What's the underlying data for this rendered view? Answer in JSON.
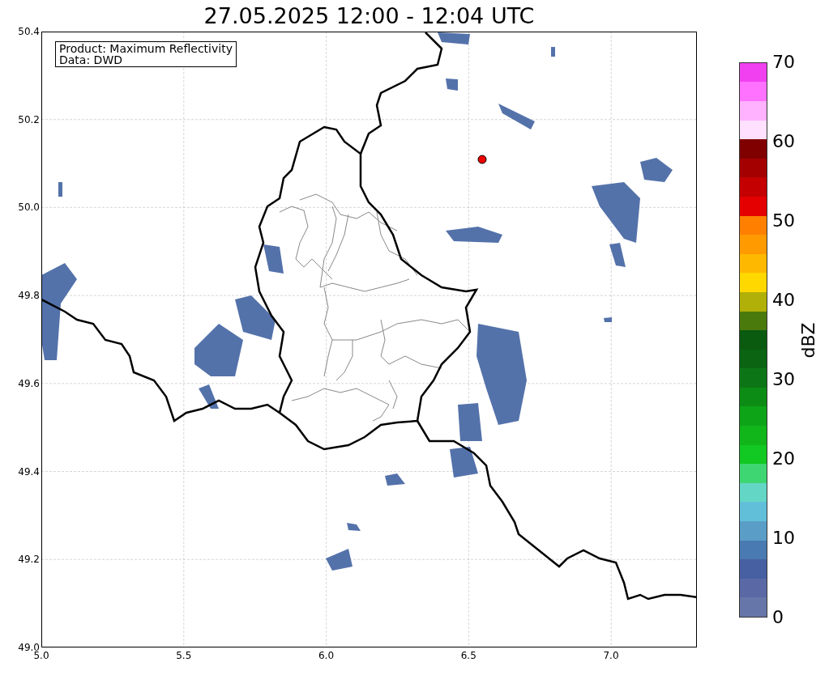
{
  "title": "27.05.2025 12:00 - 12:04 UTC",
  "info_box": [
    "Product: Maximum Reflectivity",
    "Data: DWD"
  ],
  "y_ticks": [
    "50.4",
    "50.2",
    "50.0",
    "49.8",
    "49.6",
    "49.4",
    "49.2",
    "49.0"
  ],
  "x_ticks": [
    "5.0",
    "5.5",
    "6.0",
    "6.5",
    "7.0"
  ],
  "colorbar": {
    "label": "dBZ",
    "ticks": [
      "70",
      "60",
      "50",
      "40",
      "30",
      "20",
      "10",
      "0"
    ],
    "bins": [
      {
        "color": "#6676a8"
      },
      {
        "color": "#5a69a6"
      },
      {
        "color": "#4660a2"
      },
      {
        "color": "#4a7ab2"
      },
      {
        "color": "#5a9ec8"
      },
      {
        "color": "#62bfd9"
      },
      {
        "color": "#64d6c6"
      },
      {
        "color": "#3ed672"
      },
      {
        "color": "#12c822"
      },
      {
        "color": "#10b61a"
      },
      {
        "color": "#0ea418"
      },
      {
        "color": "#0c8c14"
      },
      {
        "color": "#0c7616"
      },
      {
        "color": "#0a6412"
      },
      {
        "color": "#0a5a10"
      },
      {
        "color": "#4a7a0c"
      },
      {
        "color": "#b0b008"
      },
      {
        "color": "#ffd800"
      },
      {
        "color": "#ffb800"
      },
      {
        "color": "#ff9a00"
      },
      {
        "color": "#ff8000"
      },
      {
        "color": "#e40000"
      },
      {
        "color": "#c40000"
      },
      {
        "color": "#a40000"
      },
      {
        "color": "#800000"
      },
      {
        "color": "#ffe0ff"
      },
      {
        "color": "#ffb2ff"
      },
      {
        "color": "#ff72ff"
      },
      {
        "color": "#f040f0"
      }
    ]
  }
}
